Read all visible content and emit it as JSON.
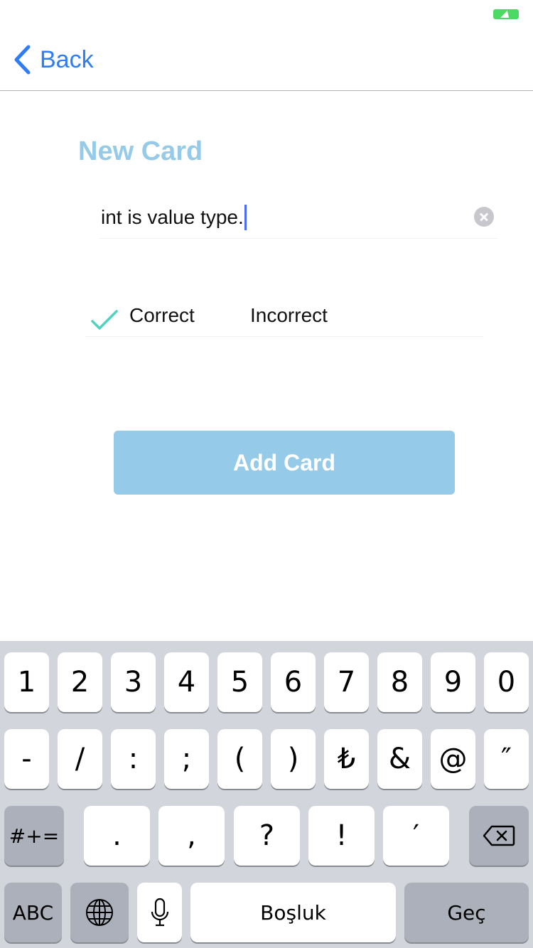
{
  "nav": {
    "back_label": "Back"
  },
  "form": {
    "title": "New Card",
    "question_value": "int is value type.",
    "answer_options": {
      "correct": "Correct",
      "incorrect": "Incorrect",
      "selected": "Correct"
    },
    "add_button": "Add Card"
  },
  "colors": {
    "accent_blue": "#2f7cf6",
    "title_blue": "#95cbe8",
    "button_blue": "#95cbe8",
    "check_teal": "#4fd3c0",
    "battery_green": "#4cd964"
  },
  "icons": [
    "battery-icon",
    "back-chevron-icon",
    "clear-icon",
    "checkmark-icon",
    "delete-icon",
    "globe-icon",
    "microphone-icon"
  ],
  "keyboard": {
    "row1": [
      "1",
      "2",
      "3",
      "4",
      "5",
      "6",
      "7",
      "8",
      "9",
      "0"
    ],
    "row2": [
      "-",
      "/",
      ":",
      ";",
      "(",
      ")",
      "₺",
      "&",
      "@",
      "″"
    ],
    "row3": {
      "shift_label": "#+=",
      "keys": [
        ".",
        ",",
        "?",
        "!",
        "′"
      ]
    },
    "row4": {
      "abc_label": "ABC",
      "space_label": "Boşluk",
      "return_label": "Geç"
    }
  }
}
